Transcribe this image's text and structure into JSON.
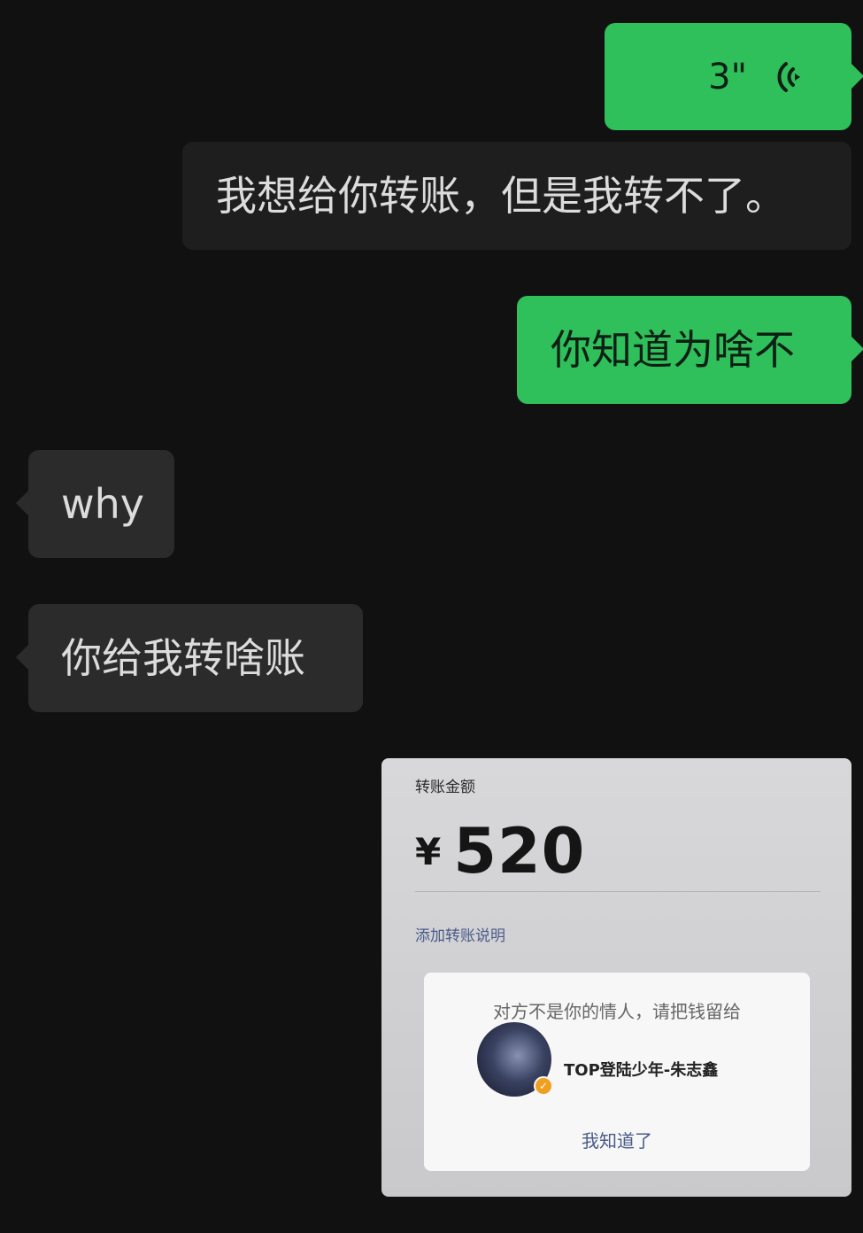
{
  "messages": [
    {
      "type": "voice",
      "side": "sent",
      "duration": "3\"",
      "icon": "voice-wave-icon"
    },
    {
      "type": "text",
      "side": "recv",
      "text": "我想给你转账，但是我转不了。"
    },
    {
      "type": "text",
      "side": "sent",
      "text": "你知道为啥不"
    },
    {
      "type": "text",
      "side": "recv",
      "text": "why"
    },
    {
      "type": "text",
      "side": "recv",
      "text": "你给我转啥账"
    }
  ],
  "transfer_screenshot": {
    "label": "转账金额",
    "currency": "¥",
    "amount": "520",
    "note_link": "添加转账说明",
    "dialog": {
      "message": "对方不是你的情人，请把钱留给",
      "username": "TOP登陆少年-朱志鑫",
      "confirm": "我知道了"
    }
  },
  "colors": {
    "background": "#111111",
    "sent_bubble": "#2fbf5b",
    "recv_bubble": "#2b2b2b"
  }
}
